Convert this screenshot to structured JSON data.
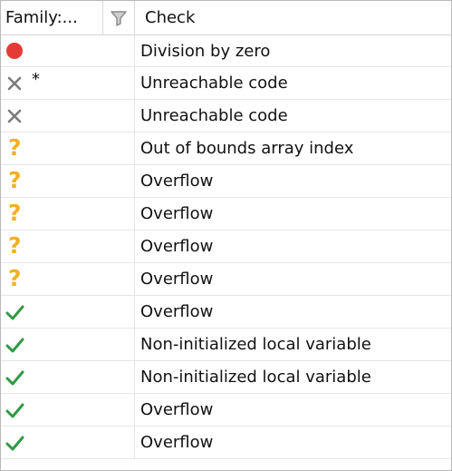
{
  "header": {
    "family_label": "Family:...",
    "filter_icon": "filter-icon",
    "check_label": "Check"
  },
  "rows": [
    {
      "icon": "red-dot",
      "marker": "",
      "check": "Division by zero"
    },
    {
      "icon": "gray-x",
      "marker": "*",
      "check": "Unreachable code"
    },
    {
      "icon": "gray-x",
      "marker": "",
      "check": "Unreachable code"
    },
    {
      "icon": "orange-question",
      "marker": "",
      "check": "Out of bounds array index"
    },
    {
      "icon": "orange-question",
      "marker": "",
      "check": "Overflow"
    },
    {
      "icon": "orange-question",
      "marker": "",
      "check": "Overflow"
    },
    {
      "icon": "orange-question",
      "marker": "",
      "check": "Overflow"
    },
    {
      "icon": "orange-question",
      "marker": "",
      "check": "Overflow"
    },
    {
      "icon": "green-check",
      "marker": "",
      "check": "Overflow"
    },
    {
      "icon": "green-check",
      "marker": "",
      "check": "Non-initialized local variable"
    },
    {
      "icon": "green-check",
      "marker": "",
      "check": "Non-initialized local variable"
    },
    {
      "icon": "green-check",
      "marker": "",
      "check": "Overflow"
    },
    {
      "icon": "green-check",
      "marker": "",
      "check": "Overflow"
    }
  ],
  "colors": {
    "red": "#e53b36",
    "gray": "#7b7b7b",
    "orange": "#f2b124",
    "green": "#2f9a45"
  }
}
